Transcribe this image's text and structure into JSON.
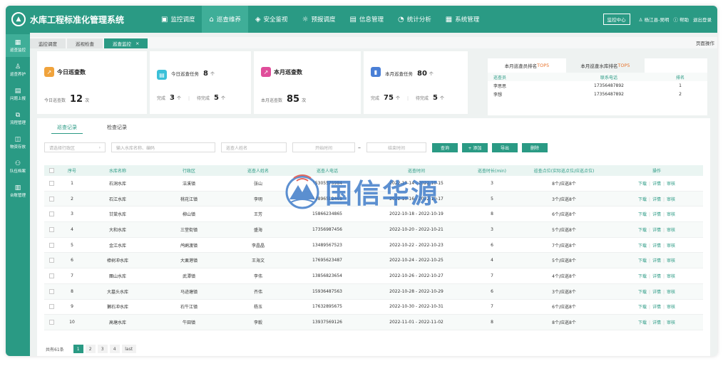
{
  "app": {
    "title": "水库工程标准化管理系统"
  },
  "nav": [
    {
      "icon": "monitor-icon",
      "label": "监控调度"
    },
    {
      "icon": "inspection-icon",
      "label": "巡查维养"
    },
    {
      "icon": "shield-icon",
      "label": "安全鉴视"
    },
    {
      "icon": "alert-icon",
      "label": "预报调度"
    },
    {
      "icon": "document-icon",
      "label": "信息管理"
    },
    {
      "icon": "chart-icon",
      "label": "统计分析"
    },
    {
      "icon": "system-icon",
      "label": "系统管理"
    }
  ],
  "topright": {
    "monitor_center": "监控中心",
    "user": "杨江县-吴明",
    "help": "帮助",
    "logout": "退出登录"
  },
  "sidebar": [
    {
      "icon": "grid-icon",
      "label": "巡查监控"
    },
    {
      "icon": "user-icon",
      "label": "巡查养护"
    },
    {
      "icon": "report-icon",
      "label": "问题上报"
    },
    {
      "icon": "flow-icon",
      "label": "流程管理"
    },
    {
      "icon": "box-icon",
      "label": "物资存放"
    },
    {
      "icon": "people-icon",
      "label": "队伍档案"
    },
    {
      "icon": "list-icon",
      "label": "台账管理"
    }
  ],
  "tabs": [
    {
      "label": "监控调度",
      "active": false
    },
    {
      "label": "巡视检查",
      "active": false
    },
    {
      "label": "巡查监控",
      "active": true,
      "close": "×"
    }
  ],
  "page_ops": "页面操作",
  "cards": {
    "today": {
      "title": "今日巡查数",
      "label": "今日巡查数",
      "value": "12",
      "unit": "次",
      "color": "#f0a33c"
    },
    "today_task": {
      "title": "今日巡查任务",
      "value": "8",
      "unit": "个",
      "done_label": "完成",
      "done": "3",
      "done_unit": "个",
      "todo_label": "待完成",
      "todo": "5",
      "todo_unit": "个",
      "color": "#3ac0d8"
    },
    "month": {
      "title": "本月巡查数",
      "label": "本月巡查数",
      "value": "85",
      "unit": "次",
      "color": "#e04d9a"
    },
    "month_task": {
      "title": "本月巡查任务",
      "value": "80",
      "unit": "个",
      "done_label": "完成",
      "done": "75",
      "done_unit": "个",
      "todo_label": "待完成",
      "todo": "5",
      "todo_unit": "个",
      "color": "#4a7fd6"
    }
  },
  "ranking": {
    "tabs": [
      {
        "prefix": "本月巡查员排名",
        "hl": "TOP5",
        "active": false
      },
      {
        "prefix": "本月巡查水库排名",
        "hl": "TOP5",
        "active": true
      }
    ],
    "headers": [
      "巡查员",
      "联系电话",
      "排名"
    ],
    "rows": [
      [
        "李思思",
        "17356487892",
        "1"
      ],
      [
        "李想",
        "17356487892",
        "2"
      ]
    ]
  },
  "subtabs": [
    "巡查记录",
    "检查记录"
  ],
  "filters": {
    "area_placeholder": "请选择行政区",
    "reservoir_placeholder": "输入水库名称、编码",
    "person_placeholder": "巡查人姓名",
    "start_placeholder": "开始时间",
    "dash": "–",
    "end_placeholder": "结束时间",
    "query": "查询",
    "add": "+ 添加",
    "export": "导出",
    "delete": "删除"
  },
  "table": {
    "headers": [
      "序号",
      "水库名称",
      "行政区",
      "巡查人姓名",
      "巡查人电话",
      "巡查时间",
      "巡查时长(min)",
      "巡查点位(实际巡点位/应巡点位)",
      "操作"
    ],
    "rows": [
      [
        "1",
        "石洞水库",
        "洁溪镇",
        "张山",
        "15305575984",
        "2022-10-14 - 2022-10-15",
        "3",
        "8个/应巡8个"
      ],
      [
        "2",
        "石江水库",
        "桃花江镇",
        "李明",
        "13896512468",
        "2022-10-16 - 2022-10-17",
        "5",
        "3个/应巡8个"
      ],
      [
        "3",
        "甘棠水库",
        "柳山镇",
        "王芳",
        "15866234865",
        "2022-10-18 - 2022-10-19",
        "8",
        "6个/应巡8个"
      ],
      [
        "4",
        "大和水库",
        "三堂街镇",
        "盛海",
        "17356987456",
        "2022-10-20 - 2022-10-21",
        "3",
        "5个/应巡8个"
      ],
      [
        "5",
        "金江水库",
        "鸬鹚渡镇",
        "李晶晶",
        "13489567523",
        "2022-10-22 - 2022-10-23",
        "6",
        "7个/应巡8个"
      ],
      [
        "6",
        "樟树冲水库",
        "大栗港镇",
        "王海文",
        "17695623487",
        "2022-10-24 - 2022-10-25",
        "4",
        "5个/应巡8个"
      ],
      [
        "7",
        "團山水库",
        "武潭镇",
        "李伟",
        "13856823654",
        "2022-10-26 - 2022-10-27",
        "7",
        "4个/应巡8个"
      ],
      [
        "8",
        "大墓头水库",
        "马迹塘镇",
        "齐伟",
        "15936487563",
        "2022-10-28 - 2022-10-29",
        "6",
        "3个/应巡8个"
      ],
      [
        "9",
        "獭石冲水库",
        "石牛江镇",
        "杨玉",
        "17632895675",
        "2022-10-30 - 2022-10-31",
        "7",
        "6个/应巡8个"
      ],
      [
        "10",
        "高塘水库",
        "牛田镇",
        "李毅",
        "13937569126",
        "2022-11-01 - 2022-11-02",
        "8",
        "8个/应巡8个"
      ]
    ],
    "ops": [
      "下载",
      "详情",
      "审核"
    ]
  },
  "pager": {
    "total": "共有61条",
    "pages": [
      "1",
      "2",
      "3",
      "4"
    ],
    "last": "last"
  },
  "watermark": {
    "text": "国信华源"
  },
  "colors": {
    "primary": "#2a9a84",
    "accent": "#e8732b"
  }
}
